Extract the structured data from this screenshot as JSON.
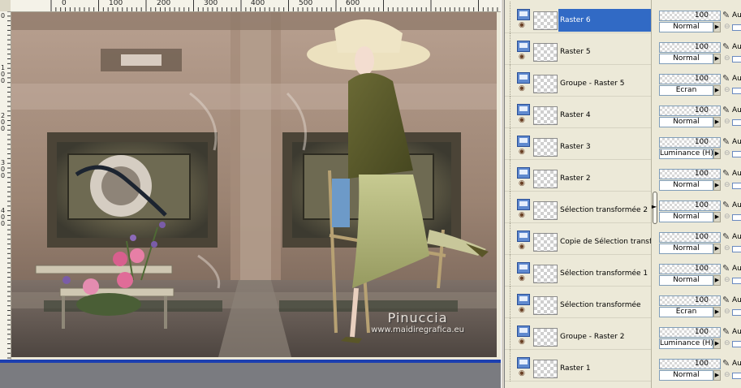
{
  "rulers": {
    "horizontal": [
      "0",
      "100",
      "200",
      "300",
      "400",
      "500",
      "600"
    ],
    "vertical": [
      "0",
      "1\n0\n0",
      "2\n0\n0",
      "3\n0\n0",
      "4\n0\n0"
    ]
  },
  "image": {
    "watermark_title": "Pinuccia",
    "watermark_url": "www.maidiregrafica.eu"
  },
  "layers": [
    {
      "name": "Raster 6",
      "opacity": "100",
      "blend": "Normal",
      "selected": true
    },
    {
      "name": "Raster 5",
      "opacity": "100",
      "blend": "Normal",
      "selected": false
    },
    {
      "name": "Groupe - Raster 5",
      "opacity": "100",
      "blend": "Écran",
      "selected": false
    },
    {
      "name": "Raster 4",
      "opacity": "100",
      "blend": "Normal",
      "selected": false
    },
    {
      "name": "Raster 3",
      "opacity": "100",
      "blend": "Luminance (H)",
      "selected": false
    },
    {
      "name": "Raster 2",
      "opacity": "100",
      "blend": "Normal",
      "selected": false
    },
    {
      "name": "Sélection transformée 2",
      "opacity": "100",
      "blend": "Normal",
      "selected": false
    },
    {
      "name": "Copie de Sélection transformée",
      "opacity": "100",
      "blend": "Normal",
      "selected": false
    },
    {
      "name": "Sélection transformée 1",
      "opacity": "100",
      "blend": "Normal",
      "selected": false
    },
    {
      "name": "Sélection transformée",
      "opacity": "100",
      "blend": "Écran",
      "selected": false
    },
    {
      "name": "Groupe - Raster 2",
      "opacity": "100",
      "blend": "Luminance (H)",
      "selected": false
    },
    {
      "name": "Raster 1",
      "opacity": "100",
      "blend": "Normal",
      "selected": false
    }
  ],
  "layer_props": {
    "auto_label": "Au"
  },
  "colors": {
    "selection": "#316ac5",
    "panel": "#ece9d8",
    "scroll_strip": "#1c3fb0"
  }
}
